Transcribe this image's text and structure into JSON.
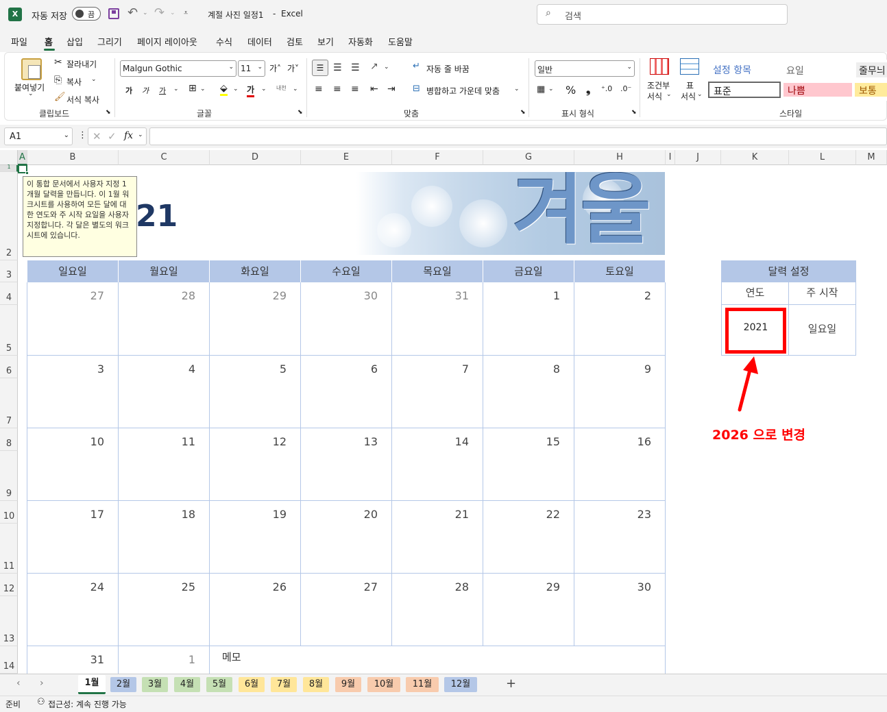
{
  "app": {
    "autosave_label": "자동 저장",
    "autosave_state": "끔",
    "doc_title": "계절 사진 일정1",
    "app_name": "Excel",
    "search_placeholder": "검색",
    "title_sep": "-"
  },
  "menu": [
    "파일",
    "홈",
    "삽입",
    "그리기",
    "페이지 레이아웃",
    "수식",
    "데이터",
    "검토",
    "보기",
    "자동화",
    "도움말"
  ],
  "ribbon": {
    "clipboard": {
      "paste": "붙여넣기",
      "cut": "잘라내기",
      "copy": "복사",
      "format_painter": "서식 복사",
      "label": "클립보드"
    },
    "font": {
      "name": "Malgun Gothic",
      "size": "11",
      "label": "글꼴",
      "grow": "가˄",
      "shrink": "가˅",
      "bold": "가",
      "italic": "가",
      "underline": "가",
      "color_letter": "가",
      "phonetic": "내천"
    },
    "alignment": {
      "wrap": "자동 줄 바꿈",
      "merge": "병합하고 가운데 맞춤",
      "label": "맞춤"
    },
    "number": {
      "format": "일반",
      "label": "표시 형식",
      "percent": "%",
      "comma": "❟"
    },
    "styles": {
      "cond1": "조건부",
      "cond2": "서식",
      "table1": "표",
      "table2": "서식",
      "label": "스타일",
      "setting_item": "설정 항목",
      "weekday": "요일",
      "more": "줄무늬",
      "normal": "표준",
      "bad": "나쁨",
      "neutral": "보통"
    }
  },
  "formula": {
    "namebox": "A1",
    "fx": "fx",
    "value": ""
  },
  "columns": [
    "A",
    "B",
    "C",
    "D",
    "E",
    "F",
    "G",
    "H",
    "I",
    "J",
    "K",
    "L",
    "M"
  ],
  "rows": [
    "1",
    "2",
    "3",
    "4",
    "5",
    "6",
    "7",
    "8",
    "9",
    "10",
    "11",
    "12",
    "13",
    "14"
  ],
  "tooltip": "이 통합 문서에서 사용자 지정 1개월 달력을 만듭니다. 이 1월 워크시트를 사용하여 모든 달에 대한 연도와 주 시작 요일을 사용자 지정합니다. 각 달은 별도의 워크시트에 있습니다.",
  "year_display": "21",
  "banner_text": "겨울",
  "weekdays": [
    "일요일",
    "월요일",
    "화요일",
    "수요일",
    "목요일",
    "금요일",
    "토요일"
  ],
  "weeks": [
    [
      "27",
      "28",
      "29",
      "30",
      "31",
      "1",
      "2"
    ],
    [
      "3",
      "4",
      "5",
      "6",
      "7",
      "8",
      "9"
    ],
    [
      "10",
      "11",
      "12",
      "13",
      "14",
      "15",
      "16"
    ],
    [
      "17",
      "18",
      "19",
      "20",
      "21",
      "22",
      "23"
    ],
    [
      "24",
      "25",
      "26",
      "27",
      "28",
      "29",
      "30"
    ],
    [
      "31",
      "1"
    ]
  ],
  "memo_label": "메모",
  "settings": {
    "title": "달력 설정",
    "year_label": "연도",
    "week_start_label": "주 시작",
    "year_value": "2021",
    "week_start_value": "일요일"
  },
  "annotation": {
    "text": "2026 으로 변경",
    "color": "#ff0000"
  },
  "tabs": [
    {
      "label": "1월",
      "color": "#ffffff",
      "active": true
    },
    {
      "label": "2월",
      "color": "#b4c7e7"
    },
    {
      "label": "3월",
      "color": "#c5e0b4"
    },
    {
      "label": "4월",
      "color": "#c5e0b4"
    },
    {
      "label": "5월",
      "color": "#c5e0b4"
    },
    {
      "label": "6월",
      "color": "#ffe699"
    },
    {
      "label": "7월",
      "color": "#ffe699"
    },
    {
      "label": "8월",
      "color": "#ffe699"
    },
    {
      "label": "9월",
      "color": "#f8cbad"
    },
    {
      "label": "10월",
      "color": "#f8cbad"
    },
    {
      "label": "11월",
      "color": "#f8cbad"
    },
    {
      "label": "12월",
      "color": "#b4c7e7"
    }
  ],
  "add_sheet": "+",
  "status": {
    "ready": "준비",
    "accessibility": "접근성: 계속 진행 가능"
  },
  "colors": {
    "header_blue": "#b4c7e7",
    "title_navy": "#1f3864",
    "excel_green": "#217346"
  }
}
